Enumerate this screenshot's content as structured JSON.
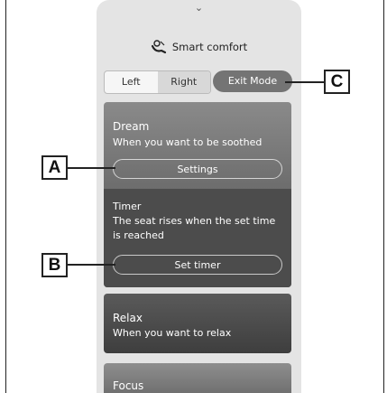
{
  "panel": {
    "collapse_icon": "chevron-down-icon",
    "title": "Smart comfort",
    "title_icon": "seat-icon"
  },
  "seat_selector": {
    "options": [
      "Left",
      "Right"
    ],
    "selected": "Right"
  },
  "exit_label": "Exit Mode",
  "dream": {
    "title": "Dream",
    "subtitle": "When you want to be soothed",
    "settings_label": "Settings",
    "timer_title": "Timer",
    "timer_desc_line1": "The seat rises when the set time",
    "timer_desc_line2": "is reached",
    "set_timer_label": "Set timer"
  },
  "relax": {
    "title": "Relax",
    "subtitle": "When you want to relax"
  },
  "focus": {
    "title": "Focus"
  },
  "callouts": {
    "a": "A",
    "b": "B",
    "c": "C"
  }
}
